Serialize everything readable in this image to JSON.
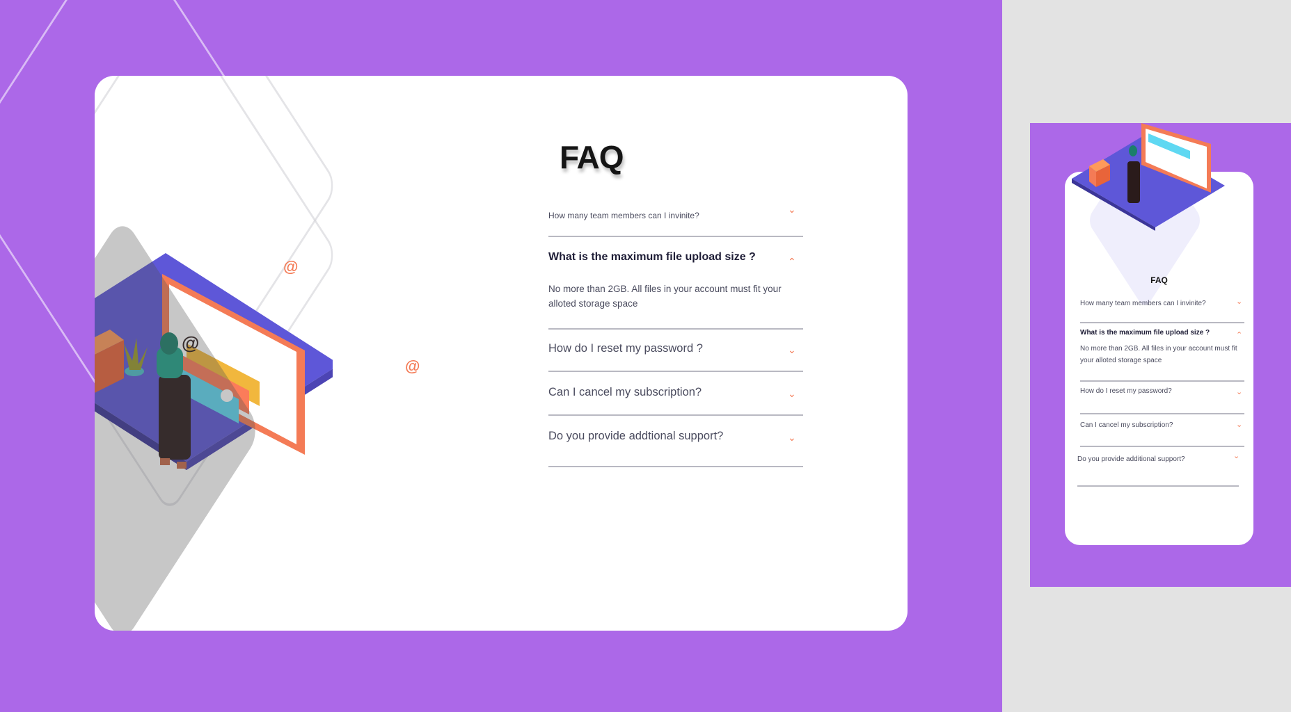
{
  "desktop": {
    "title": "FAQ",
    "items": [
      {
        "question": "How many team members can I invinite?",
        "chevron": "⌄"
      },
      {
        "question": "What  is the maximum file  upload size ?",
        "chevron": "⌃",
        "answer": "No more than 2GB. All files in your account must fit your alloted storage  space"
      },
      {
        "question": "How do I reset my password ?",
        "chevron": "⌄"
      },
      {
        "question": "Can I cancel my subscription?",
        "chevron": "⌄"
      },
      {
        "question": "Do you provide addtional support?",
        "chevron": "⌄"
      }
    ]
  },
  "mobile": {
    "title": "FAQ",
    "items": [
      {
        "question": "How many team members can I invinite?",
        "chevron": "⌄"
      },
      {
        "question": "What  is the maximum file  upload size ?",
        "chevron": "⌃",
        "answer": "No more than 2GB. All files in your account must fit your alloted storage  space"
      },
      {
        "question": "How do I reset my password?",
        "chevron": "⌄"
      },
      {
        "question": "Can I cancel my subscription?",
        "chevron": "⌄"
      },
      {
        "question": "Do you provide additional support?",
        "chevron": "⌄"
      }
    ]
  },
  "theme": {
    "background": "#ac68e8",
    "accent": "#f47b56",
    "heading": "#1f1e37",
    "text": "#4a4b5e",
    "divider": "#b9b9c2"
  },
  "icons": {
    "chevron": "chevron-icon",
    "at_sign": "at-sign-icon"
  }
}
